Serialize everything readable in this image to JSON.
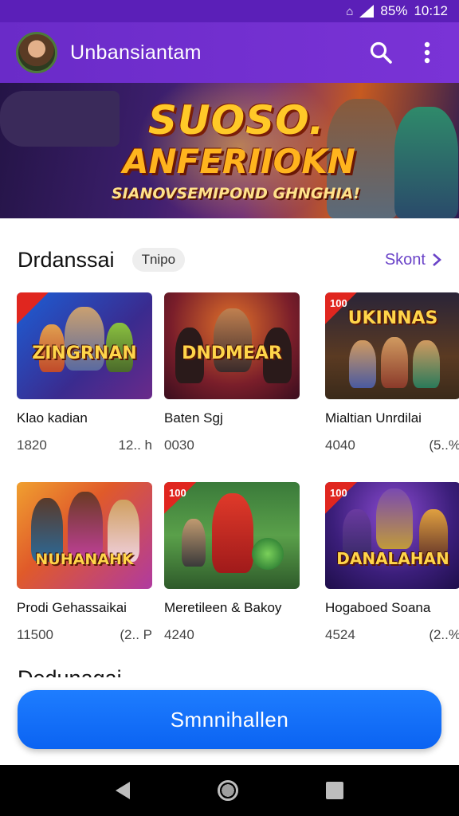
{
  "status_bar": {
    "battery": "85%",
    "time": "10:12"
  },
  "app_bar": {
    "title": "Unbansiantam",
    "search_icon": "search-icon",
    "menu_icon": "more-vert-icon"
  },
  "banner": {
    "line1": "SUOSO.",
    "line2": "ANFERIIOKN",
    "line3": "SIANOVSEMIPOND GHNGHIA!"
  },
  "section": {
    "title": "Drdanssai",
    "tag": "Tnipo",
    "see_all": "Skont"
  },
  "cards": [
    {
      "thumb_title": "ZINGRNAN",
      "name": "Klao kadian",
      "stat": "1820",
      "extra": "12.. h",
      "bg": "#3a2b8f",
      "accent": "#1c5fd6"
    },
    {
      "thumb_title": "DNDMEAR",
      "name": "Baten Sgj",
      "stat": "0030",
      "extra": "",
      "bg": "#5a1a2a",
      "accent": "#c24a1a"
    },
    {
      "thumb_title": "UKINNAS",
      "badge": "100",
      "name": "Mialtian Unrdilai",
      "stat": "4040",
      "extra": "(5..%",
      "bg": "#2a2438",
      "accent": "#8a5a22"
    },
    {
      "thumb_title": "NUHANAHK",
      "name": "Prodi Gehassaikai",
      "stat": "11500",
      "extra": "(2.. P",
      "bg": "#e07a1a",
      "accent": "#c03a9a"
    },
    {
      "thumb_title": "",
      "badge": "100",
      "name": "Meretileen & Bakoy",
      "stat": "4240",
      "extra": "",
      "bg": "#2e6a2a",
      "accent": "#d23a2a"
    },
    {
      "thumb_title": "DANALAHAN",
      "badge": "100",
      "name": "Hogaboed Soana",
      "stat": "4524",
      "extra": "(2..%",
      "bg": "#3b1e7a",
      "accent": "#e2862a"
    }
  ],
  "section2": {
    "title": "Dedunagai"
  },
  "cta": {
    "label": "Smnnihallen"
  },
  "nav": {
    "back_icon": "back-icon",
    "home_icon": "home-icon",
    "recent_icon": "recents-icon"
  }
}
